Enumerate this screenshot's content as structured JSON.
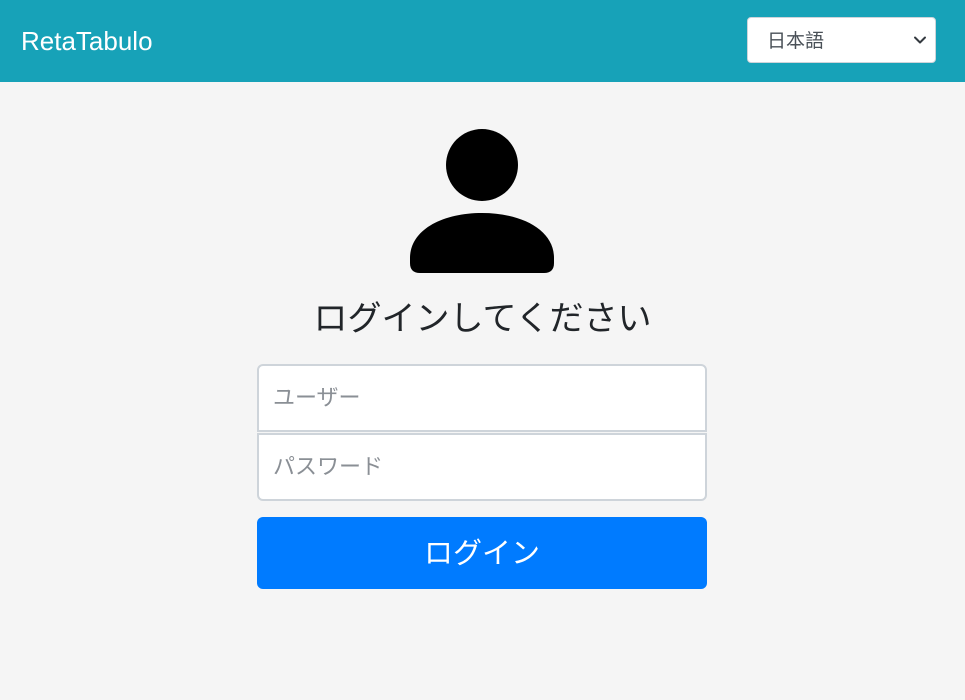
{
  "header": {
    "brand": "RetaTabulo",
    "language_select": {
      "selected": "日本語",
      "icon": "chevron-down-icon"
    },
    "background_color": "#17a2b8"
  },
  "login": {
    "avatar_icon": "user-icon",
    "heading": "ログインしてください",
    "username": {
      "value": "",
      "placeholder": "ユーザー"
    },
    "password": {
      "value": "",
      "placeholder": "パスワード"
    },
    "submit_label": "ログイン",
    "submit_color": "#007bff"
  }
}
